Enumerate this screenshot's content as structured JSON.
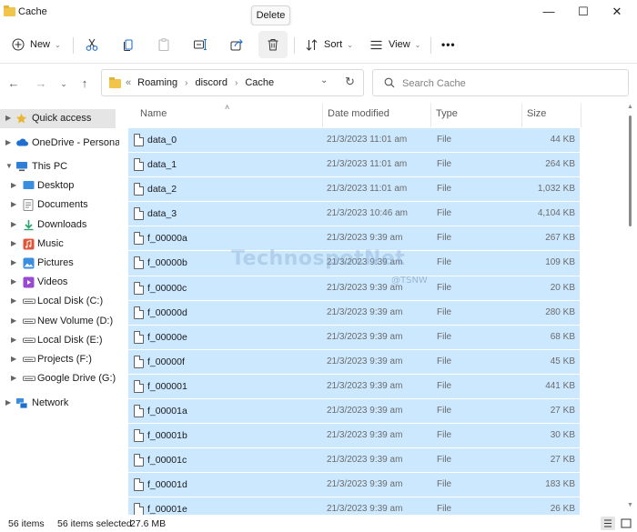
{
  "window": {
    "title": "Cache",
    "tooltip": "Delete",
    "minimize_glyph": "—",
    "maximize_glyph": "☐",
    "close_glyph": "✕"
  },
  "toolbar": {
    "new_label": "New",
    "sort_label": "Sort",
    "view_label": "View",
    "more_label": "•••",
    "icons": [
      "plus-icon",
      "cut-icon",
      "copy-icon",
      "paste-icon",
      "rename-icon",
      "share-icon",
      "delete-icon",
      "sort-icon",
      "view-icon",
      "more-icon"
    ]
  },
  "address": {
    "overflow": "«",
    "crumbs": [
      "Roaming",
      "discord",
      "Cache"
    ],
    "search_placeholder": "Search Cache"
  },
  "nav": {
    "items": [
      {
        "label": "Quick access",
        "icon": "star-icon",
        "selected": true
      },
      {
        "label": "OneDrive - Personal",
        "icon": "cloud-icon"
      },
      {
        "label": "This PC",
        "icon": "computer-icon",
        "expanded": true
      },
      {
        "label": "Desktop",
        "icon": "desktop-icon"
      },
      {
        "label": "Documents",
        "icon": "documents-icon"
      },
      {
        "label": "Downloads",
        "icon": "downloads-icon"
      },
      {
        "label": "Music",
        "icon": "music-icon"
      },
      {
        "label": "Pictures",
        "icon": "pictures-icon"
      },
      {
        "label": "Videos",
        "icon": "videos-icon"
      },
      {
        "label": "Local Disk (C:)",
        "icon": "drive-icon"
      },
      {
        "label": "New Volume (D:)",
        "icon": "drive-icon"
      },
      {
        "label": "Local Disk (E:)",
        "icon": "drive-icon"
      },
      {
        "label": "Projects (F:)",
        "icon": "drive-icon"
      },
      {
        "label": "Google Drive (G:)",
        "icon": "drive-icon"
      },
      {
        "label": "Network",
        "icon": "network-icon"
      }
    ]
  },
  "files": {
    "columns": {
      "name": "Name",
      "date": "Date modified",
      "type": "Type",
      "size": "Size"
    },
    "rows": [
      {
        "name": "data_0",
        "date": "21/3/2023 11:01 am",
        "type": "File",
        "size": "44 KB"
      },
      {
        "name": "data_1",
        "date": "21/3/2023 11:01 am",
        "type": "File",
        "size": "264 KB"
      },
      {
        "name": "data_2",
        "date": "21/3/2023 11:01 am",
        "type": "File",
        "size": "1,032 KB"
      },
      {
        "name": "data_3",
        "date": "21/3/2023 10:46 am",
        "type": "File",
        "size": "4,104 KB"
      },
      {
        "name": "f_00000a",
        "date": "21/3/2023 9:39 am",
        "type": "File",
        "size": "267 KB"
      },
      {
        "name": "f_00000b",
        "date": "21/3/2023 9:39 am",
        "type": "File",
        "size": "109 KB"
      },
      {
        "name": "f_00000c",
        "date": "21/3/2023 9:39 am",
        "type": "File",
        "size": "20 KB"
      },
      {
        "name": "f_00000d",
        "date": "21/3/2023 9:39 am",
        "type": "File",
        "size": "280 KB"
      },
      {
        "name": "f_00000e",
        "date": "21/3/2023 9:39 am",
        "type": "File",
        "size": "68 KB"
      },
      {
        "name": "f_00000f",
        "date": "21/3/2023 9:39 am",
        "type": "File",
        "size": "45 KB"
      },
      {
        "name": "f_000001",
        "date": "21/3/2023 9:39 am",
        "type": "File",
        "size": "441 KB"
      },
      {
        "name": "f_00001a",
        "date": "21/3/2023 9:39 am",
        "type": "File",
        "size": "27 KB"
      },
      {
        "name": "f_00001b",
        "date": "21/3/2023 9:39 am",
        "type": "File",
        "size": "30 KB"
      },
      {
        "name": "f_00001c",
        "date": "21/3/2023 9:39 am",
        "type": "File",
        "size": "27 KB"
      },
      {
        "name": "f_00001d",
        "date": "21/3/2023 9:39 am",
        "type": "File",
        "size": "183 KB"
      },
      {
        "name": "f_00001e",
        "date": "21/3/2023 9:39 am",
        "type": "File",
        "size": "26 KB"
      }
    ]
  },
  "watermark": {
    "text": "TechnospotNet",
    "sub": "@TSNW"
  },
  "status": {
    "items_count": "56 items",
    "selected": "56 items selected",
    "size": "27.6 MB"
  },
  "colors": {
    "selection": "#cce8ff",
    "folder": "#f0c54a",
    "accent": "#0067c0"
  }
}
